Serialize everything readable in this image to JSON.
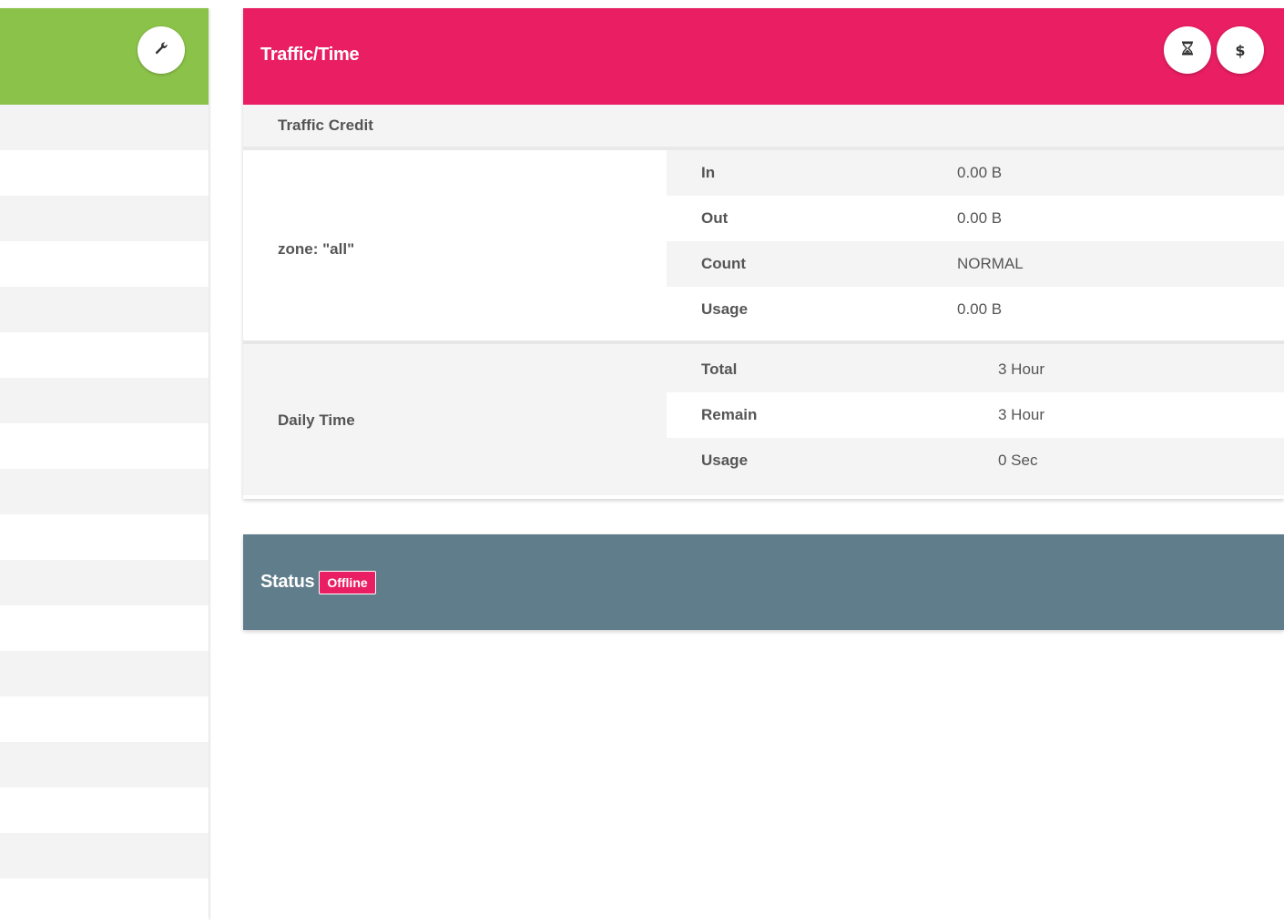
{
  "colors": {
    "left_header": "#8bc34a",
    "traffic_header": "#e91e63",
    "status_header": "#607d8b",
    "badge_offline": "#e91e63"
  },
  "left_panel": {
    "tool_icon": "wrench-icon",
    "row_count": 18
  },
  "traffic_card": {
    "title": "Traffic/Time",
    "buttons": [
      {
        "icon": "hourglass-icon",
        "glyph": "⧗"
      },
      {
        "icon": "dollar-icon",
        "glyph": "$"
      }
    ],
    "section_title": "Traffic Credit",
    "zone": {
      "label": "zone: \"all\"",
      "rows": [
        {
          "key": "In",
          "value": "0.00 B"
        },
        {
          "key": "Out",
          "value": "0.00 B"
        },
        {
          "key": "Count",
          "value": "NORMAL"
        },
        {
          "key": "Usage",
          "value": "0.00 B"
        }
      ]
    },
    "daily": {
      "label": "Daily Time",
      "rows": [
        {
          "key": "Total",
          "value": "3 Hour"
        },
        {
          "key": "Remain",
          "value": "3 Hour"
        },
        {
          "key": "Usage",
          "value": "0 Sec"
        }
      ]
    }
  },
  "status_card": {
    "title": "Status",
    "badge": "Offline"
  }
}
